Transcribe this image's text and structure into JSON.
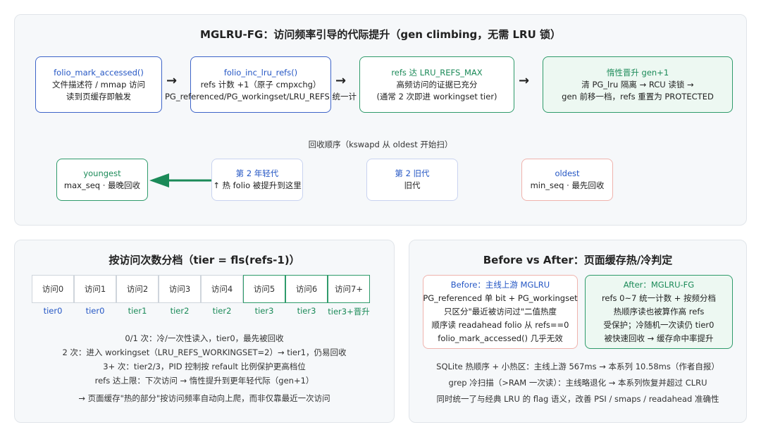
{
  "top": {
    "title": "MGLRU-FG：访问频率引导的代际提升（gen climbing，无需 LRU 锁）",
    "flow": [
      {
        "title": "folio_mark_accessed()",
        "lines": [
          "文件描述符 / mmap 访问",
          "读到页缓存即触发"
        ]
      },
      {
        "title": "folio_inc_lru_refs()",
        "lines": [
          "refs 计数 +1（原子 cmpxchg）",
          "PG_referenced/PG_workingset/LRU_REFS 统一计"
        ]
      },
      {
        "title": "refs 达 LRU_REFS_MAX",
        "lines": [
          "高频访问的证据已充分",
          "(通常 2 次即进 workingset tier)"
        ]
      },
      {
        "title": "惰性晋升 gen+1",
        "lines": [
          "清 PG_lru 隔离 → RCU 读锁 →",
          "gen 前移一档，refs 重置为 PROTECTED"
        ]
      }
    ],
    "arrow_glyph": "→",
    "reclaim_label": "回收顺序（kswapd 从 oldest 开始扫）",
    "gens": [
      {
        "title": "youngest",
        "line": "max_seq · 最晚回收"
      },
      {
        "title": "第 2 年轻代",
        "line": "↑ 热 folio 被提升到这里"
      },
      {
        "title": "第 2 旧代",
        "line": "旧代"
      },
      {
        "title": "oldest",
        "line": "min_seq · 最先回收"
      }
    ]
  },
  "tiers": {
    "title": "按访问次数分档（tier = fls(refs-1)）",
    "cells": [
      "访问0",
      "访问1",
      "访问2",
      "访问3",
      "访问4",
      "访问5",
      "访问6",
      "访问7+"
    ],
    "labels": [
      "tier0",
      "tier0",
      "tier1",
      "tier2",
      "tier2",
      "tier3",
      "tier3",
      "tier3+晋升"
    ],
    "notes": [
      "0/1 次：冷/一次性读入，tier0，最先被回收",
      "2 次：进入 workingset（LRU_REFS_WORKINGSET=2）→ tier1，仍易回收",
      "3+ 次：tier2/3，PID 控制按 refault 比例保护更高档位",
      "refs 达上限：下次访问 → 惰性提升到更年轻代际（gen+1）",
      "→ 页面缓存\"热的部分\"按访问频率自动向上爬，而非仅靠最近一次访问"
    ]
  },
  "compare": {
    "title": "Before vs After：页面缓存热/冷判定",
    "before": {
      "title": "Before：主线上游 MGLRU",
      "lines": [
        "PG_referenced 单 bit + PG_workingset",
        "只区分\"最近被访问过\"二值热度",
        "顺序读 readahead folio 从 refs==0",
        "folio_mark_accessed() 几乎无效"
      ]
    },
    "after": {
      "title": "After：MGLRU-FG",
      "lines": [
        "refs 0~7 统一计数 + 按频分档",
        "热顺序读也被算作高 refs",
        "受保护；冷随机一次读仍 tier0",
        "被快速回收 → 缓存命中率提升"
      ]
    },
    "notes": [
      "SQLite 热顺序 + 小热区：主线上游 567ms → 本系列 10.58ms（作者自报）",
      "grep 冷扫描（>RAM 一次读）：主线略退化 → 本系列恢复并超过 CLRU",
      "同时统一了与经典 LRU 的 flag 语义，改善 PSI / smaps / readahead 准确性"
    ]
  }
}
